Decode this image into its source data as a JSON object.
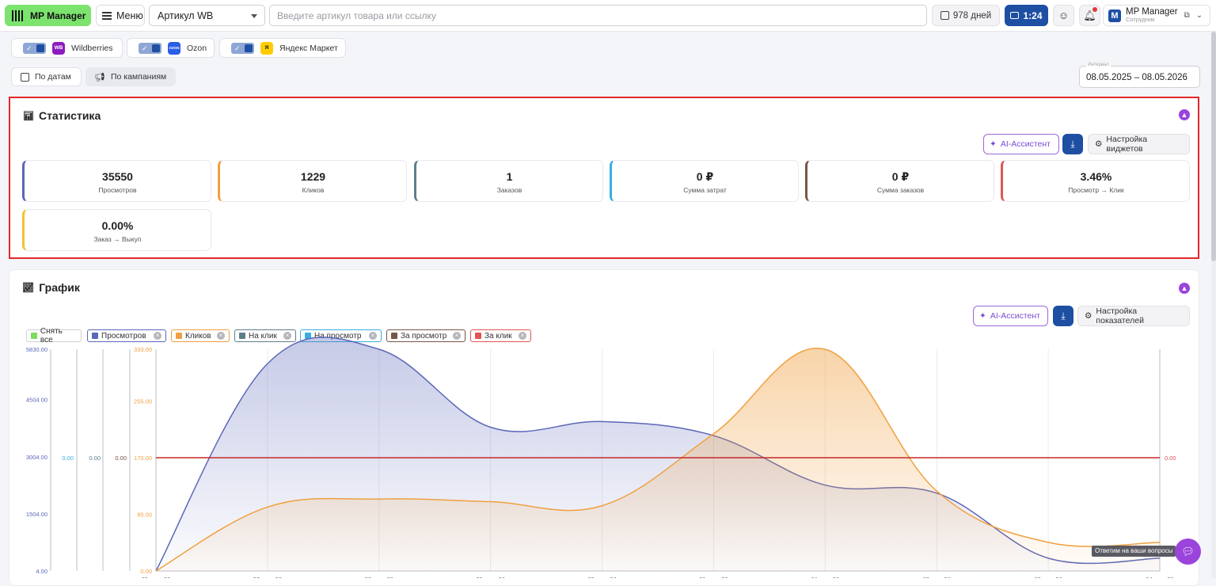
{
  "app": {
    "logo_text": "MP Manager",
    "menu_label": "Меню"
  },
  "header": {
    "select_value": "Артикул WB",
    "search_placeholder": "Введите артикул товара или ссылку",
    "days_label": "978 дней",
    "timer": "1:24",
    "user_name": "MP Manager",
    "user_role": "Сотрудник",
    "user_initial": "M"
  },
  "marketplaces": [
    {
      "label": "Wildberries",
      "badge": "WB",
      "color": "#8c1cbf"
    },
    {
      "label": "Ozon",
      "badge": "OZON",
      "color": "#2a5ee8"
    },
    {
      "label": "Яндекс Маркет",
      "badge": "Я",
      "color": "#ffcc00"
    }
  ],
  "view_buttons": {
    "by_dates": "По датам",
    "by_campaigns": "По кампаниям"
  },
  "interval": {
    "label": "Интервал",
    "value": "08.05.2025 – 08.05.2026"
  },
  "stats": {
    "title": "Статистика",
    "ai_label": "AI-Ассистент",
    "settings_label": "Настройка виджетов",
    "cards": [
      {
        "value": "35550",
        "label": "Просмотров",
        "color": "#5b67b8"
      },
      {
        "value": "1229",
        "label": "Кликов",
        "color": "#f0a040"
      },
      {
        "value": "1",
        "label": "Заказов",
        "color": "#607d8b"
      },
      {
        "value": "0 ₽",
        "label": "Сумма затрат",
        "color": "#3aaee0"
      },
      {
        "value": "0 ₽",
        "label": "Сумма заказов",
        "color": "#795548"
      },
      {
        "value": "3.46%",
        "label": "Просмотр → Клик",
        "color": "#e05555"
      },
      {
        "value": "0.00%",
        "label": "Заказ → Выкуп",
        "color": "#f2c230"
      }
    ]
  },
  "graph": {
    "title": "График",
    "ai_label": "AI-Ассистент",
    "settings_label": "Настройка показателей",
    "legend": [
      {
        "label": "Снять все",
        "color": "#7ddc5a",
        "removable": false
      },
      {
        "label": "Просмотров",
        "color": "#5b67b8",
        "removable": true
      },
      {
        "label": "Кликов",
        "color": "#f0a040",
        "removable": true
      },
      {
        "label": "На клик",
        "color": "#607d8b",
        "removable": true
      },
      {
        "label": "На просмотр",
        "color": "#3aaee0",
        "removable": true
      },
      {
        "label": "За просмотр",
        "color": "#795548",
        "removable": true
      },
      {
        "label": "За клик",
        "color": "#e05555",
        "removable": true
      }
    ]
  },
  "chart_data": {
    "type": "area",
    "x": [
      "25 мар. 26",
      "27 мар. 26",
      "28 мар. 26",
      "29 мар. 26",
      "30 мар. 26",
      "31 мар. 26",
      "01 апр. 26",
      "02 апр. 26",
      "03 апр. 26",
      "04 апр. 26"
    ],
    "axes": {
      "views": {
        "ticks": [
          "4.00",
          "1504.00",
          "3004.00",
          "4504.00",
          "5830.00"
        ],
        "ylim": [
          4,
          5830
        ]
      },
      "clicks": {
        "ticks": [
          "0.00",
          "85.00",
          "170.00",
          "255.00",
          "333.00"
        ],
        "ylim": [
          0,
          333
        ]
      },
      "per_click": {
        "ticks": [
          "0.00"
        ]
      },
      "per_view": {
        "ticks": [
          "0.00"
        ]
      },
      "za_prosmotr": {
        "ticks": [
          "0.00"
        ]
      },
      "za_klik": {
        "ticks": [
          "0.00"
        ]
      }
    },
    "series": [
      {
        "name": "Просмотров",
        "color": "#5b67b8",
        "axis": "views",
        "values": [
          4,
          5450,
          5830,
          3780,
          3930,
          3560,
          2260,
          2050,
          340,
          340
        ]
      },
      {
        "name": "Кликов",
        "color": "#f0a040",
        "axis": "clicks",
        "values": [
          0,
          96,
          108,
          104,
          98,
          206,
          333,
          120,
          43,
          43
        ]
      },
      {
        "name": "За клик",
        "color": "#c62828",
        "axis": "clicks",
        "values": [
          170,
          170,
          170,
          170,
          170,
          170,
          170,
          170,
          170,
          170
        ]
      }
    ]
  },
  "support": {
    "tooltip": "Ответим на ваши вопросы"
  }
}
